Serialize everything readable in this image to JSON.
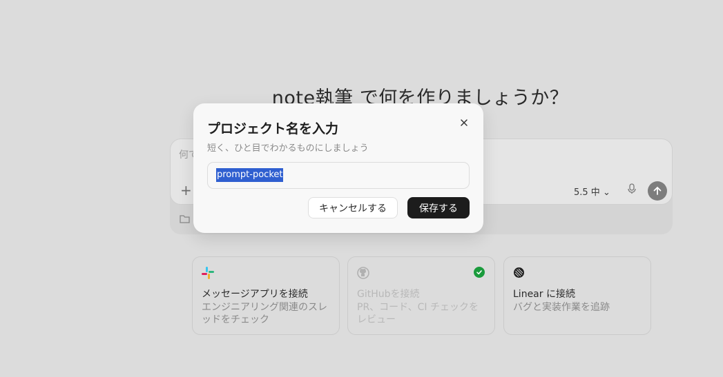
{
  "page": {
    "headline": "note執筆 で何を作りましょうか？"
  },
  "composer": {
    "placeholder": "何で",
    "model_label": "5.5 中"
  },
  "cards": [
    {
      "title": "メッセージアプリを接続",
      "description": "エンジニアリング関連のスレッドをチェック",
      "icon": "slack-icon",
      "connected": false,
      "dimmed": false
    },
    {
      "title": "GitHubを接続",
      "description": "PR、コード、CI チェックをレビュー",
      "icon": "github-icon",
      "connected": true,
      "dimmed": true
    },
    {
      "title": "Linear に接続",
      "description": "バグと実装作業を追跡",
      "icon": "linear-icon",
      "connected": false,
      "dimmed": false
    }
  ],
  "dialog": {
    "title": "プロジェクト名を入力",
    "subtitle": "短く、ひと目でわかるものにしましょう",
    "input_value": "prompt-pocket",
    "cancel_label": "キャンセルする",
    "save_label": "保存する"
  },
  "colors": {
    "selection": "#2f5fd0",
    "save_button": "#1c1c1c",
    "connected_check": "#1a9b3c"
  }
}
